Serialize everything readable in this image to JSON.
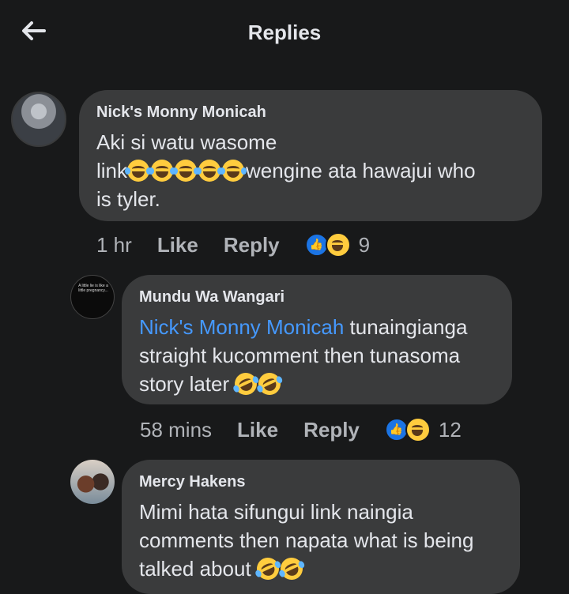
{
  "header": {
    "title": "Replies",
    "back_icon": "arrow-left-icon"
  },
  "comments": [
    {
      "author": "Nick's Monny Monicah",
      "text_line1": "Aki si watu wasome",
      "text_prefix": "link",
      "text_suffix": "wengine ata hawajui who",
      "text_line3": "is tyler.",
      "emoji_name": "face-with-tears-of-joy",
      "time": "1 hr",
      "like_label": "Like",
      "reply_label": "Reply",
      "reaction_count": "9"
    },
    {
      "author": "Mundu Wa Wangari",
      "mention": "Nick's Monny Monicah",
      "text_line1_rest": " tunaingianga",
      "text_line2": "straight kucomment then tunasoma",
      "text_line3": "story later",
      "emoji_name": "rolling-on-the-floor-laughing",
      "avatar_quote": "A little lie is like a little pregnancy – it doesn't take long before everyone knows. C.S. Lewis",
      "time": "58 mins",
      "like_label": "Like",
      "reply_label": "Reply",
      "reaction_count": "12"
    },
    {
      "author": "Mercy Hakens",
      "text_line1": "Mimi hata sifungui link naingia",
      "text_line2": "comments then napata what is being",
      "text_line3": "talked about",
      "emoji_name": "rolling-on-the-floor-laughing"
    }
  ],
  "colors": {
    "background": "#18191a",
    "bubble": "#3a3b3c",
    "text": "#e4e6eb",
    "muted": "#b0b3b8",
    "mention": "#4599ff",
    "like_blue": "#1b74e4"
  }
}
